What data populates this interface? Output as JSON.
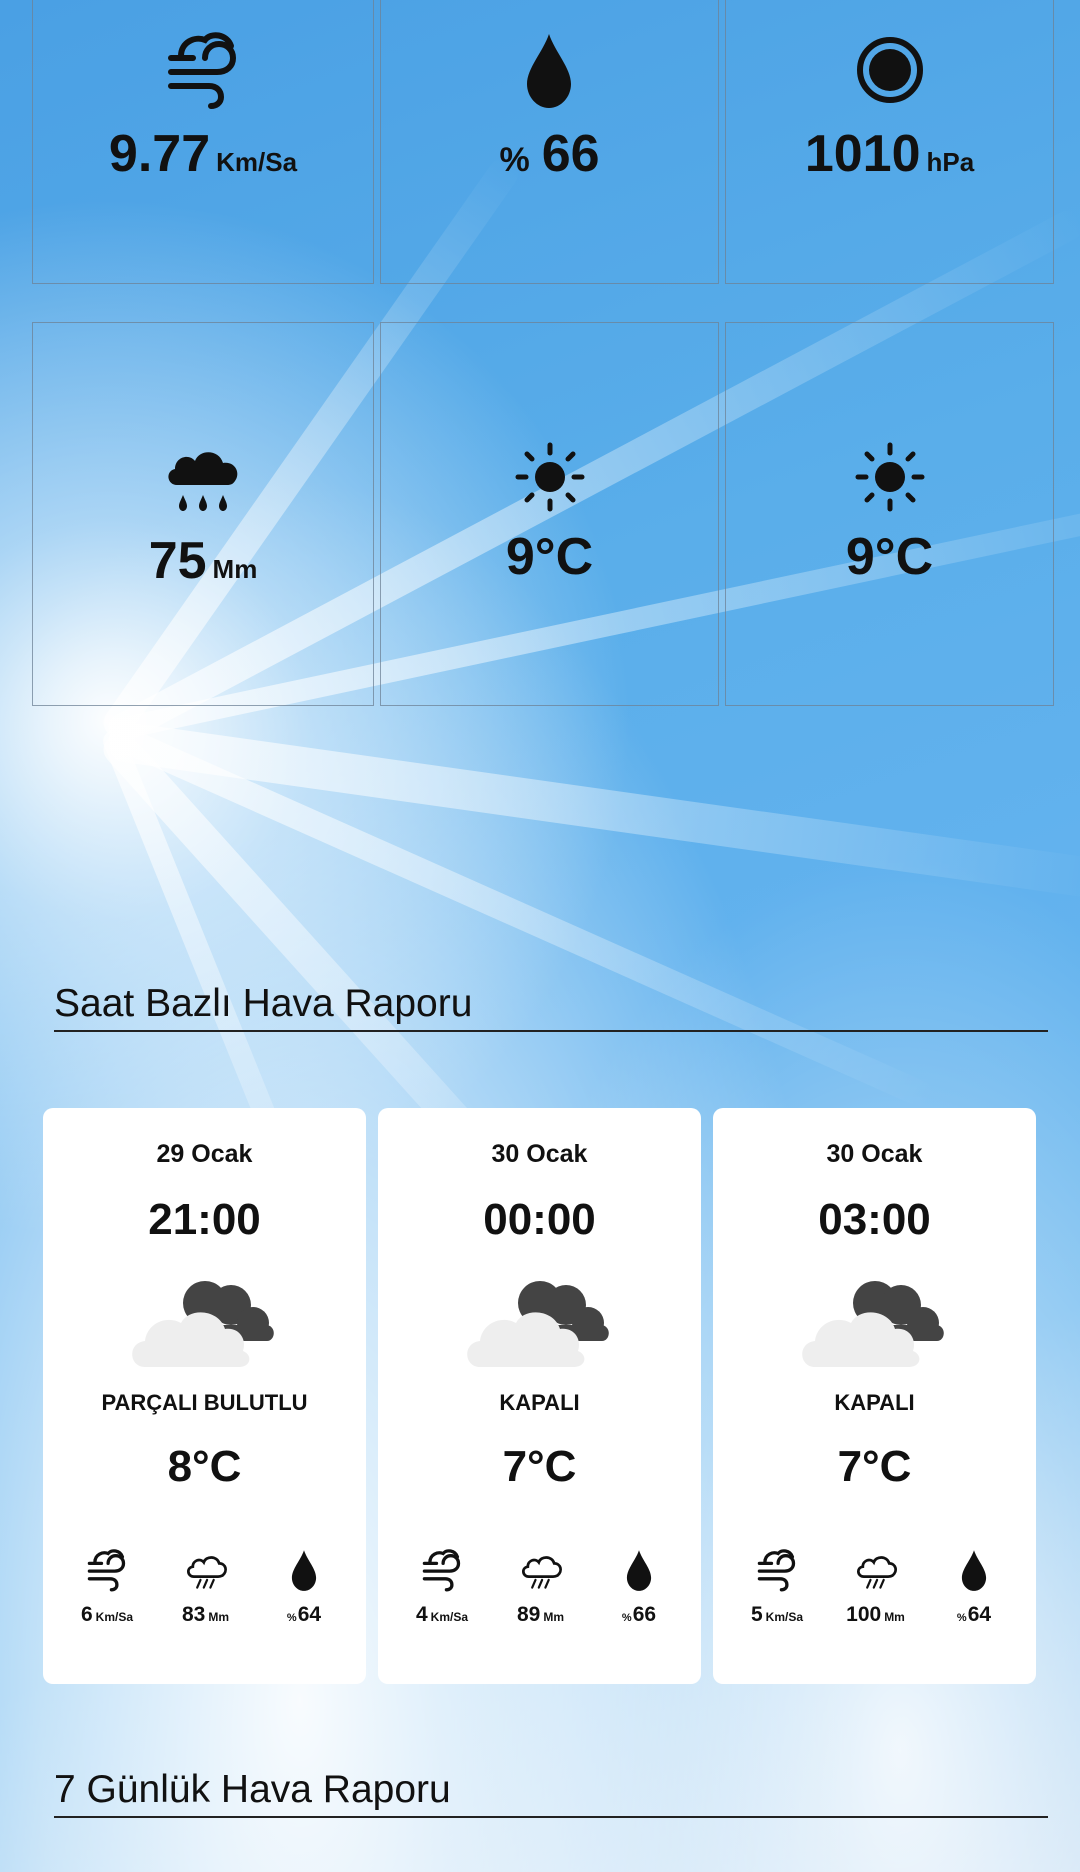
{
  "current": {
    "wind": {
      "icon": "wind-icon",
      "value": "9.77",
      "unit": "Km/Sa"
    },
    "humidity": {
      "icon": "droplet-icon",
      "prefix": "%",
      "value": "66"
    },
    "pressure": {
      "icon": "pressure-ring-icon",
      "value": "1010",
      "unit": "hPa"
    },
    "precipitation": {
      "icon": "rain-cloud-icon",
      "value": "75",
      "unit": "Mm"
    },
    "temp_min": {
      "icon": "sun-icon",
      "value": "9°C"
    },
    "temp_max": {
      "icon": "sun-icon",
      "value": "9°C"
    }
  },
  "hourly": {
    "title": "Saat Bazlı Hava Raporu",
    "items": [
      {
        "date": "29 Ocak",
        "time": "21:00",
        "icon": "partly-cloudy-night-icon",
        "condition": "PARÇALI BULUTLU",
        "temp": "8°C",
        "wind": "6",
        "wind_unit": "Km/Sa",
        "rain": "83",
        "rain_unit": "Mm",
        "hum_prefix": "%",
        "humidity": "64"
      },
      {
        "date": "30 Ocak",
        "time": "00:00",
        "icon": "overcast-night-icon",
        "condition": "KAPALI",
        "temp": "7°C",
        "wind": "4",
        "wind_unit": "Km/Sa",
        "rain": "89",
        "rain_unit": "Mm",
        "hum_prefix": "%",
        "humidity": "66"
      },
      {
        "date": "30 Ocak",
        "time": "03:00",
        "icon": "overcast-night-icon",
        "condition": "KAPALI",
        "temp": "7°C",
        "wind": "5",
        "wind_unit": "Km/Sa",
        "rain": "100",
        "rain_unit": "Mm",
        "hum_prefix": "%",
        "humidity": "64"
      }
    ]
  },
  "weekly": {
    "title": "7 Günlük Hava Raporu"
  },
  "colors": {
    "sky": "#5aaeea",
    "card": "#ffffff",
    "text": "#111111",
    "cloud_light": "#eeeeee",
    "cloud_dark": "#444444"
  }
}
